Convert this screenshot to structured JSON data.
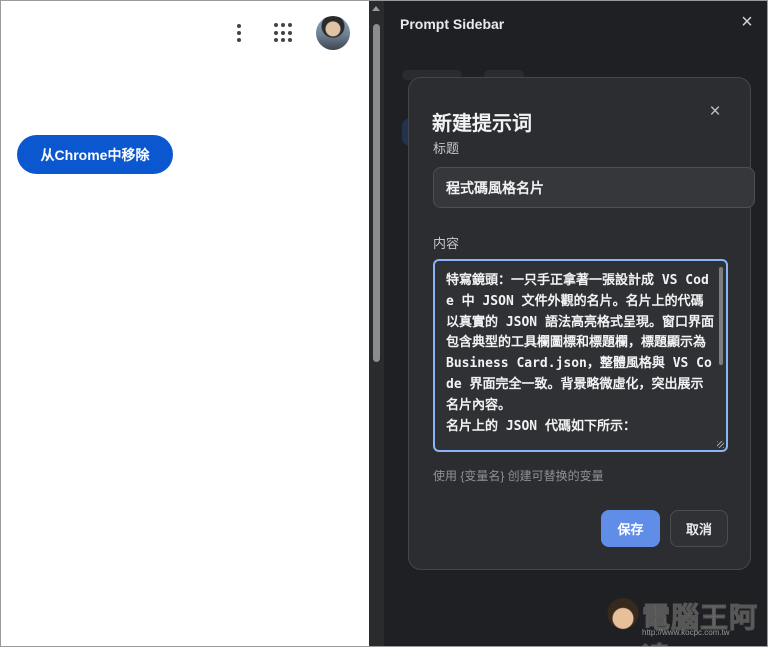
{
  "left_page": {
    "remove_button_label": "从Chrome中移除"
  },
  "side_panel": {
    "title": "Prompt Sidebar",
    "close_icon": "×",
    "dialog": {
      "title": "新建提示词",
      "close_icon": "×",
      "title_label": "标题",
      "title_value": "程式碼風格名片",
      "content_label": "内容",
      "content_value": "特寫鏡頭：一只手正拿著一張設計成 VS Code 中 JSON 文件外觀的名片。名片上的代碼以真實的 JSON 語法高亮格式呈現。窗口界面包含典型的工具欄圖標和標題欄，標題顯示為 Business Card.json，整體風格與 VS Code 界面完全一致。背景略微虛化，突出展示名片內容。\n名片上的 JSON 代碼如下所示：",
      "hint": "使用 {变量名} 创建可替换的变量",
      "save_label": "保存",
      "cancel_label": "取消"
    }
  },
  "watermark": {
    "text": "電腦王阿達",
    "url": "http://www.kocpc.com.tw"
  },
  "icons": {
    "more_menu": "kebab-vertical-icon",
    "apps": "grid-apps-icon",
    "profile": "avatar"
  },
  "colors": {
    "primary_blue": "#0b57d0",
    "save_blue": "#5f8de7",
    "panel_bg": "#1f2023",
    "dialog_bg": "#2b2d30",
    "focus_ring": "#8ab4f8"
  }
}
